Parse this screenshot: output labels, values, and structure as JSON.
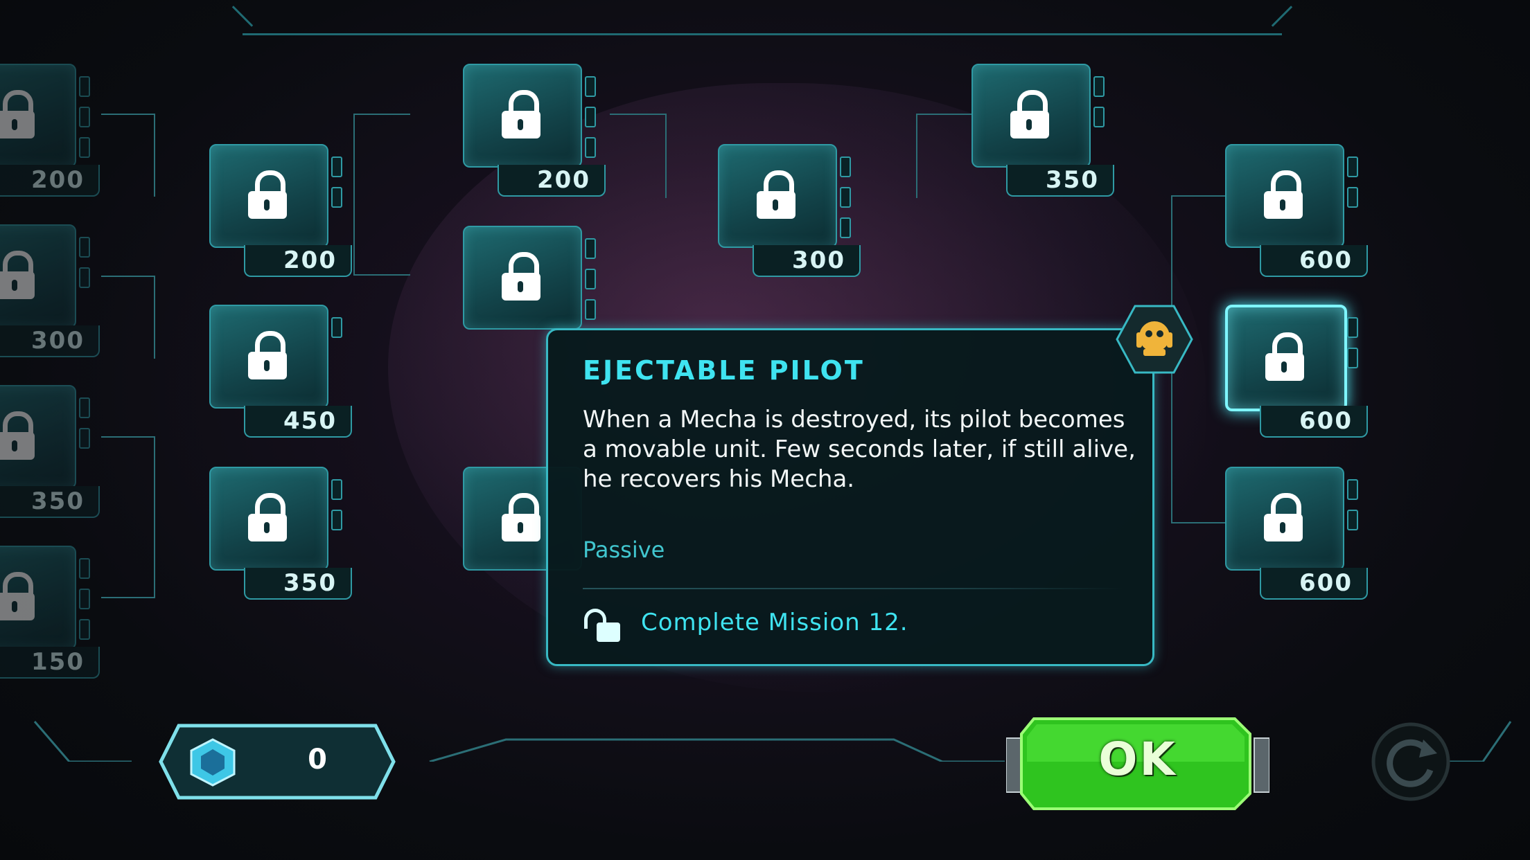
{
  "skills": [
    {
      "cost": "200",
      "state": "dim"
    },
    {
      "cost": "300",
      "state": "dim"
    },
    {
      "cost": "350",
      "state": "dim"
    },
    {
      "cost": "150",
      "state": "dim"
    },
    {
      "cost": "200",
      "state": "locked"
    },
    {
      "cost": "450",
      "state": "locked"
    },
    {
      "cost": "350",
      "state": "locked"
    },
    {
      "cost": "200",
      "state": "locked"
    },
    {
      "cost": "300",
      "state": "locked"
    },
    {
      "cost": "350",
      "state": "locked"
    },
    {
      "cost": "600",
      "state": "locked"
    },
    {
      "cost": "600",
      "state": "selected"
    },
    {
      "cost": "600",
      "state": "locked"
    }
  ],
  "popup": {
    "title": "EJECTABLE PILOT",
    "description": "When a Mecha is destroyed, its pilot becomes a movable unit. Few seconds later, if still alive, he recovers his Mecha.",
    "type": "Passive",
    "requirement": "Complete Mission  12.",
    "badge_color": "#f0b43a"
  },
  "currency": {
    "value": "0",
    "icon": "crystal-icon"
  },
  "ok_button": {
    "label": "OK",
    "color": "#3ddb2c"
  },
  "reset_button": {
    "icon": "reset-icon"
  }
}
